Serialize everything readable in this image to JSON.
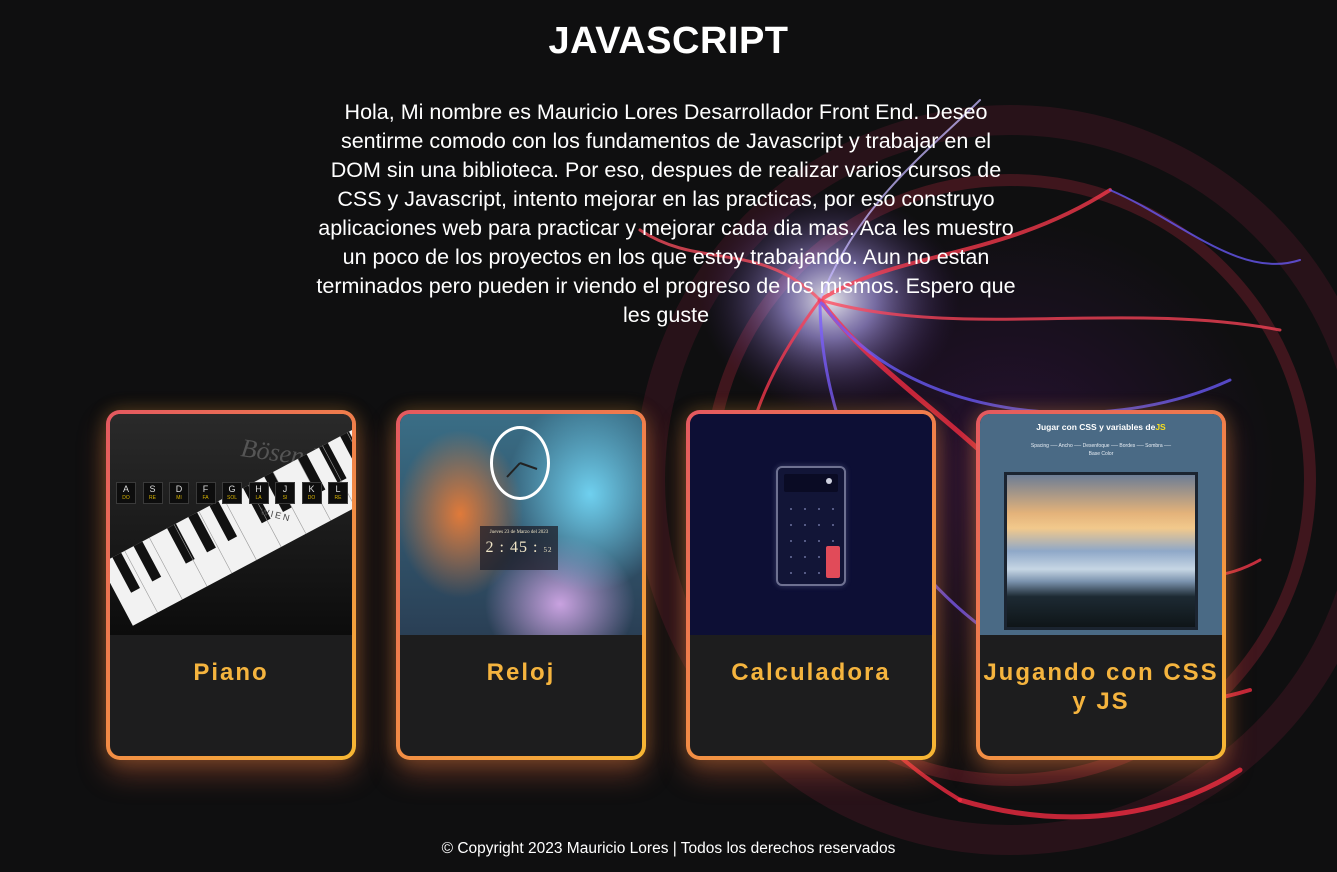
{
  "page": {
    "title": "JAVASCRIPT",
    "intro": "Hola, Mi nombre es Mauricio Lores Desarrollador Front End. Deseo sentirme comodo con los fundamentos de Javascript y trabajar en el DOM sin una biblioteca. Por eso, despues de realizar varios cursos de CSS y Javascript, intento mejorar en las practicas, por eso construyo aplicaciones web para practicar y mejorar cada dia mas. Aca les muestro un poco de los proyectos en los que estoy trabajando. Aun no estan terminados pero pueden ir viendo el progreso de los mismos. Espero que les guste"
  },
  "colors": {
    "background": "#0f0f10",
    "card_gradient_start": "#e45860",
    "card_gradient_end": "#f7b733",
    "card_title": "#f5b43e",
    "card_body": "#1d1d1e"
  },
  "projects": [
    {
      "title": "Piano",
      "preview": {
        "keys": [
          "A",
          "S",
          "D",
          "F",
          "G",
          "H",
          "J",
          "K",
          "L"
        ],
        "notes": [
          "DO",
          "RE",
          "MI",
          "FA",
          "SOL",
          "LA",
          "SI",
          "DO",
          "RE"
        ],
        "brand": "Bösendorfer",
        "city": "WIEN"
      }
    },
    {
      "title": "Reloj",
      "preview": {
        "date": "Jueves 23 de Marzo del 2023",
        "time": "2 : 45 :",
        "seconds": "52"
      }
    },
    {
      "title": "Calculadora",
      "preview": {}
    },
    {
      "title": "Jugando con CSS y JS",
      "preview": {
        "heading": "Jugar con CSS y variables de",
        "heading_js": "JS",
        "controls_row1": "Spacing ── Ancho ── Desenfoque ── Bordes ── Sombra ──",
        "controls_row2": "Base Color"
      }
    }
  ],
  "footer": {
    "text": "© Copyright 2023 Mauricio Lores | Todos los derechos reservados"
  }
}
